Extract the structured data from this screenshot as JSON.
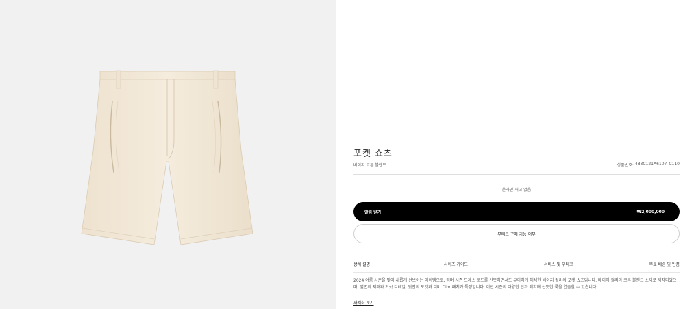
{
  "product": {
    "name": "포켓 쇼츠",
    "material": "베이지 코튼 블렌드",
    "sku_label": "상품번호:",
    "sku": "483C121A6107_C110",
    "stock_status": "온라인 재고 없음",
    "alert_label": "알림 받기",
    "price": "₩2,000,000",
    "boutique_label": "부티크 구매 가능 여부",
    "image_color": "#f1e6d4"
  },
  "tabs": [
    "상세 설명",
    "사이즈 가이드",
    "서비스 및 부티크",
    "무료 배송 및 반품"
  ],
  "description": "2024 여름 시즌을 맞아 새롭게 선보이는 아이템으로, 럼머 시즌 드레스 코드를 산뜻하면서도 우아하게 해석한 베이지 컬러의 포켓 쇼츠입니다. 베이지 컬러의 코튼 블렌드 소재로 제작되었으며, 옆면의 지퍼와 거싯 디테일, 뒷면의 포켓과 러버 Dior 패치가 특징입니다. 이번 시즌의 다양한 탑과 매치해 산뜻한 룩을 연출할 수 있습니다.",
  "more_link": "자세히 보기"
}
